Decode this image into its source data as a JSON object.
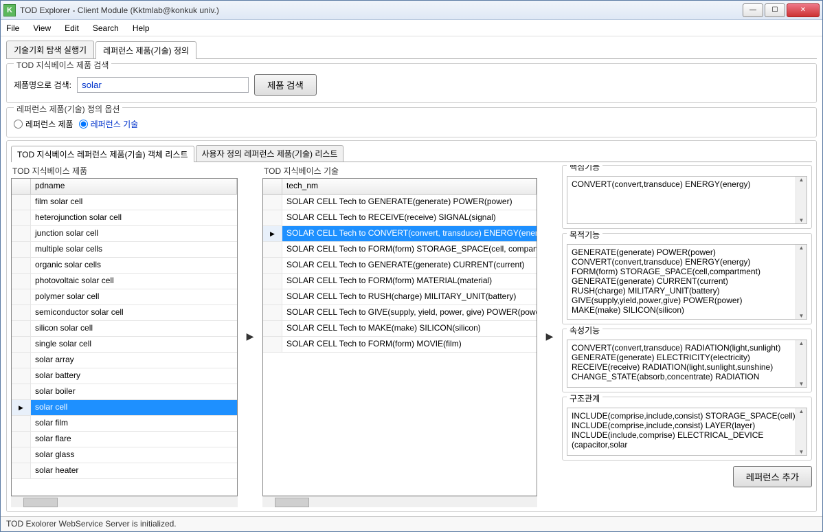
{
  "window": {
    "title": "TOD Explorer - Client Module (Kktmlab@konkuk univ.)",
    "icon_label": "K"
  },
  "menu": [
    "File",
    "View",
    "Edit",
    "Search",
    "Help"
  ],
  "maintabs": {
    "tab1": "기술기회 탐색 실행기",
    "tab2": "레퍼런스 제품(기술) 정의"
  },
  "search_panel": {
    "legend": "TOD 지식베이스 제품 검색",
    "label": "제품명으로 검색:",
    "value": "solar",
    "button": "제품 검색"
  },
  "option_panel": {
    "legend": "레퍼런스 제품(기술) 정의 옵션",
    "opt1": "레퍼런스 제품",
    "opt2": "레퍼런스 기술"
  },
  "subtabs": {
    "t1": "TOD 지식베이스 레퍼런스 제품(기술) 객체 리스트",
    "t2": "사용자 정의 레퍼런스 제품(기술) 리스트"
  },
  "left_col": {
    "title": "TOD 지식베이스 제품",
    "header": "pdname",
    "items": [
      "film solar cell",
      "heterojunction solar cell",
      "junction solar cell",
      "multiple solar cells",
      "organic solar cells",
      "photovoltaic solar cell",
      "polymer solar cell",
      "semiconductor solar cell",
      "silicon solar cell",
      "single solar cell",
      "solar array",
      "solar battery",
      "solar boiler",
      "solar cell",
      "solar film",
      "solar flare",
      "solar glass",
      "solar heater"
    ],
    "selected_index": 13
  },
  "mid_col": {
    "title": "TOD 지식베이스 기술",
    "header": "tech_nm",
    "items": [
      "SOLAR CELL Tech to GENERATE(generate) POWER(power)",
      "SOLAR CELL Tech to RECEIVE(receive) SIGNAL(signal)",
      "SOLAR CELL Tech to CONVERT(convert, transduce) ENERGY(energy)",
      "SOLAR CELL Tech to FORM(form) STORAGE_SPACE(cell, compartment)",
      "SOLAR CELL Tech to GENERATE(generate) CURRENT(current)",
      "SOLAR CELL Tech to FORM(form) MATERIAL(material)",
      "SOLAR CELL Tech to RUSH(charge) MILITARY_UNIT(battery)",
      "SOLAR CELL Tech to GIVE(supply, yield, power, give) POWER(power)",
      "SOLAR CELL Tech to MAKE(make) SILICON(silicon)",
      "SOLAR CELL Tech to FORM(form) MOVIE(film)"
    ],
    "selected_index": 2
  },
  "right_col": {
    "g1": {
      "legend": "핵심기능",
      "lines": [
        "CONVERT(convert,transduce) ENERGY(energy)"
      ]
    },
    "g2": {
      "legend": "목적기능",
      "lines": [
        "GENERATE(generate) POWER(power)",
        "CONVERT(convert,transduce) ENERGY(energy)",
        "FORM(form) STORAGE_SPACE(cell,compartment)",
        "GENERATE(generate) CURRENT(current)",
        "RUSH(charge) MILITARY_UNIT(battery)",
        "GIVE(supply,yield,power,give) POWER(power)",
        "MAKE(make) SILICON(silicon)"
      ]
    },
    "g3": {
      "legend": "속성기능",
      "lines": [
        "CONVERT(convert,transduce) RADIATION(light,sunlight)",
        "GENERATE(generate) ELECTRICITY(electricity)",
        "RECEIVE(receive) RADIATION(light,sunlight,sunshine)",
        "CHANGE_STATE(absorb,concentrate) RADIATION"
      ]
    },
    "g4": {
      "legend": "구조관계",
      "lines": [
        "INCLUDE(comprise,include,consist) STORAGE_SPACE(cell)",
        "INCLUDE(comprise,include,consist) LAYER(layer)",
        "INCLUDE(include,comprise) ELECTRICAL_DEVICE",
        "(capacitor,solar"
      ]
    },
    "add_btn": "레퍼런스 추가"
  },
  "status": "TOD Exolorer WebService Server is initialized."
}
